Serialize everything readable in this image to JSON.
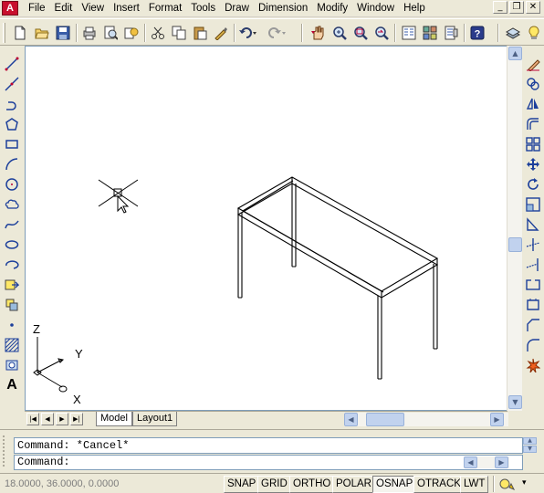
{
  "menu": {
    "items": [
      "File",
      "Edit",
      "View",
      "Insert",
      "Format",
      "Tools",
      "Draw",
      "Dimension",
      "Modify",
      "Window",
      "Help"
    ],
    "app_icon_letter": "A"
  },
  "window_buttons": {
    "minimize": "_",
    "restore": "❐",
    "close": "✕"
  },
  "toolbar": {
    "icons": [
      "new-icon",
      "open-icon",
      "save-icon",
      "print-icon",
      "plot-preview-icon",
      "publish-icon",
      "cut-icon",
      "copy-icon",
      "paste-icon",
      "match-properties-icon",
      "undo-icon",
      "redo-icon",
      "pan-icon",
      "zoom-realtime-icon",
      "zoom-window-icon",
      "zoom-previous-icon",
      "properties-icon",
      "design-center-icon",
      "tool-palettes-icon",
      "help-icon",
      "layers-icon",
      "layer-state-icon"
    ]
  },
  "draw_toolbar": {
    "icons": [
      "line-icon",
      "construction-line-icon",
      "polyline-icon",
      "polygon-icon",
      "rectangle-icon",
      "arc-icon",
      "circle-icon",
      "revision-cloud-icon",
      "spline-icon",
      "ellipse-icon",
      "ellipse-arc-icon",
      "insert-block-icon",
      "make-block-icon",
      "point-icon",
      "hatch-icon",
      "region-icon",
      "multiline-text-icon"
    ],
    "text_glyph": "A"
  },
  "modify_toolbar": {
    "icons": [
      "erase-icon",
      "copy-object-icon",
      "mirror-icon",
      "offset-icon",
      "array-icon",
      "move-icon",
      "rotate-icon",
      "scale-icon",
      "stretch-icon",
      "trim-icon",
      "extend-icon",
      "break-icon",
      "join-icon",
      "chamfer-icon",
      "fillet-icon",
      "explode-icon"
    ]
  },
  "ucs": {
    "z_label": "Z",
    "y_label": "Y",
    "x_label": "X"
  },
  "tabs": {
    "model": "Model",
    "layout1": "Layout1"
  },
  "command": {
    "history": "Command: *Cancel*",
    "prompt": "Command:"
  },
  "status": {
    "coordinates": "18.0000, 36.0000, 0.0000",
    "toggles": [
      {
        "label": "SNAP",
        "on": false
      },
      {
        "label": "GRID",
        "on": false
      },
      {
        "label": "ORTHO",
        "on": false
      },
      {
        "label": "POLAR",
        "on": false
      },
      {
        "label": "OSNAP",
        "on": true
      },
      {
        "label": "OTRACK",
        "on": false
      },
      {
        "label": "LWT",
        "on": false
      }
    ]
  },
  "colors": {
    "background": "#ece9d8",
    "drawing_bg": "#ffffff",
    "accent": "#c1d2ee",
    "brand": "#c8102e"
  }
}
